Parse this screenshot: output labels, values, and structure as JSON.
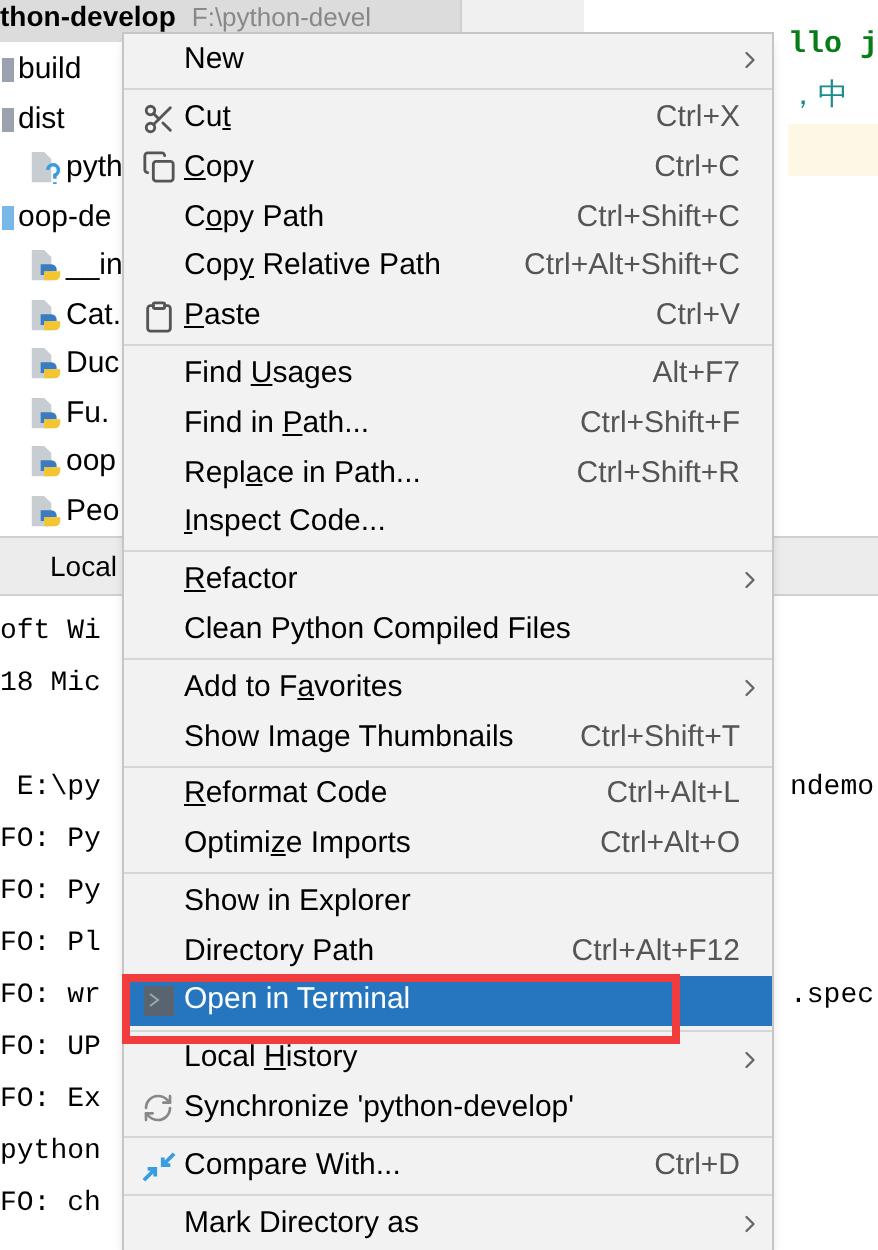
{
  "project_header": {
    "title": "thon-develop",
    "path": "F:\\python-devel"
  },
  "tree": [
    {
      "label": "build",
      "kind": "folder"
    },
    {
      "label": "dist",
      "kind": "folder",
      "children": [
        {
          "label": "pyth",
          "kind": "unknown"
        }
      ]
    },
    {
      "label": "oop-de",
      "kind": "source-folder",
      "children": [
        {
          "label": "__in",
          "kind": "python"
        },
        {
          "label": "Cat.",
          "kind": "python"
        },
        {
          "label": "Duc",
          "kind": "python"
        },
        {
          "label": "Fu.",
          "kind": "python"
        },
        {
          "label": "oop",
          "kind": "python"
        },
        {
          "label": "Peo",
          "kind": "python"
        }
      ]
    }
  ],
  "editor": {
    "lines": [
      "llo j",
      "，中"
    ]
  },
  "terminal": {
    "tab": "Local",
    "blocks": [
      [
        {
          "left": "oft Wi"
        },
        {
          "left": "18 Mic"
        }
      ],
      [
        {
          "left": " E:\\py",
          "right": "ndemo"
        },
        {
          "left": "FO: Py"
        },
        {
          "left": "FO: Py"
        },
        {
          "left": "FO: Pl"
        },
        {
          "left": "FO: wr",
          "right": ".spec"
        },
        {
          "left": "FO: UP"
        },
        {
          "left": "FO: Ex"
        },
        {
          "left": "python"
        },
        {
          "left": "FO: ch"
        }
      ]
    ]
  },
  "menu": {
    "items": [
      {
        "kind": "item",
        "pre": "New",
        "submenu": true,
        "selected": false
      },
      {
        "kind": "separator"
      },
      {
        "kind": "item",
        "pre": "Cu",
        "key": "t",
        "shortcut": "Ctrl+X",
        "submenu": false,
        "selected": false
      },
      {
        "kind": "item",
        "key": "C",
        "post": "opy",
        "shortcut": "Ctrl+C",
        "submenu": false,
        "selected": false
      },
      {
        "kind": "item",
        "pre": "C",
        "key": "o",
        "post": "py Path",
        "shortcut": "Ctrl+Shift+C",
        "submenu": false,
        "selected": false
      },
      {
        "kind": "item",
        "pre": "Cop",
        "key": "y",
        "post": " Relative Path",
        "shortcut": "Ctrl+Alt+Shift+C",
        "submenu": false,
        "selected": false
      },
      {
        "kind": "item",
        "key": "P",
        "post": "aste",
        "shortcut": "Ctrl+V",
        "submenu": false,
        "selected": false
      },
      {
        "kind": "separator"
      },
      {
        "kind": "item",
        "pre": "Find ",
        "key": "U",
        "post": "sages",
        "shortcut": "Alt+F7",
        "submenu": false,
        "selected": false
      },
      {
        "kind": "item",
        "pre": "Find in ",
        "key": "P",
        "post": "ath...",
        "shortcut": "Ctrl+Shift+F",
        "submenu": false,
        "selected": false
      },
      {
        "kind": "item",
        "pre": "Repl",
        "key": "a",
        "post": "ce in Path...",
        "shortcut": "Ctrl+Shift+R",
        "submenu": false,
        "selected": false
      },
      {
        "kind": "item",
        "key": "I",
        "post": "nspect Code...",
        "submenu": false,
        "selected": false
      },
      {
        "kind": "separator"
      },
      {
        "kind": "item",
        "key": "R",
        "post": "efactor",
        "submenu": true,
        "selected": false
      },
      {
        "kind": "item",
        "pre": "Clean Python Compiled Files",
        "submenu": false,
        "selected": false
      },
      {
        "kind": "separator"
      },
      {
        "kind": "item",
        "pre": "Add to F",
        "key": "a",
        "post": "vorites",
        "submenu": true,
        "selected": false
      },
      {
        "kind": "item",
        "pre": "Show Image Thumbnails",
        "shortcut": "Ctrl+Shift+T",
        "submenu": false,
        "selected": false
      },
      {
        "kind": "separator"
      },
      {
        "kind": "item",
        "key": "R",
        "post": "eformat Code",
        "shortcut": "Ctrl+Alt+L",
        "submenu": false,
        "selected": false
      },
      {
        "kind": "item",
        "pre": "Optimi",
        "key": "z",
        "post": "e Imports",
        "shortcut": "Ctrl+Alt+O",
        "submenu": false,
        "selected": false
      },
      {
        "kind": "separator"
      },
      {
        "kind": "item",
        "pre": "Show in Explorer",
        "submenu": false,
        "selected": false
      },
      {
        "kind": "item",
        "pre": "Directory Path",
        "shortcut": "Ctrl+Alt+F12",
        "submenu": false,
        "selected": false
      },
      {
        "kind": "item",
        "pre": "Open in Terminal",
        "submenu": false,
        "selected": true
      },
      {
        "kind": "separator"
      },
      {
        "kind": "item",
        "pre": "Local ",
        "key": "H",
        "post": "istory",
        "submenu": true,
        "selected": false
      },
      {
        "kind": "item",
        "pre": "Synchronize 'python-develop'",
        "submenu": false,
        "selected": false
      },
      {
        "kind": "separator"
      },
      {
        "kind": "item",
        "pre": "Compare With...",
        "shortcut": "Ctrl+D",
        "submenu": false,
        "selected": false
      },
      {
        "kind": "separator"
      },
      {
        "kind": "item",
        "pre": "Mark Directory as",
        "submenu": true,
        "selected": false
      }
    ]
  }
}
